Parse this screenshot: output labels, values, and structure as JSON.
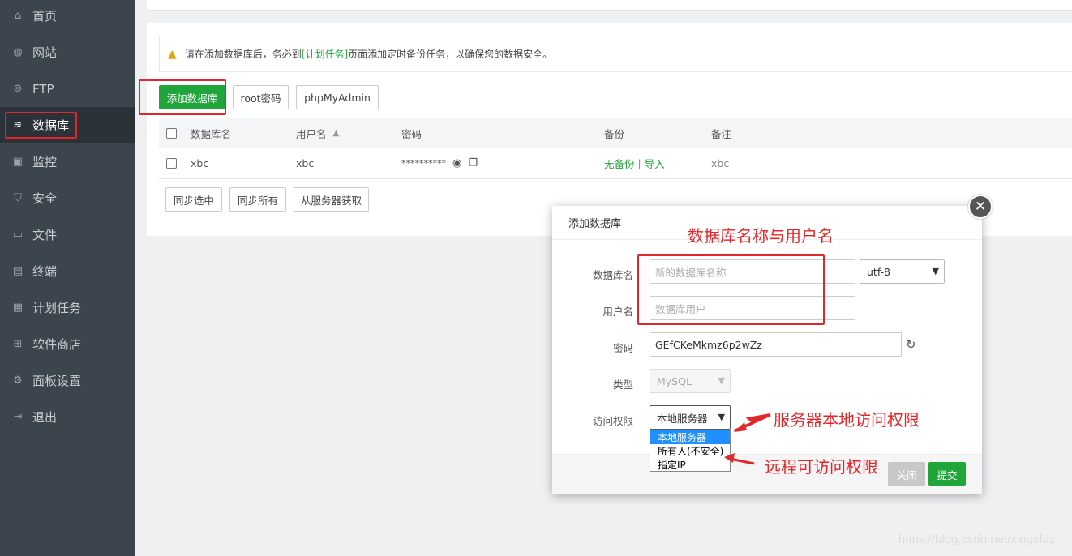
{
  "sidebar": {
    "items": [
      {
        "label": "首页",
        "icon": "home-icon",
        "glyph": "⌂"
      },
      {
        "label": "网站",
        "icon": "globe-icon",
        "glyph": "◍"
      },
      {
        "label": "FTP",
        "icon": "ftp-icon",
        "glyph": "⊜"
      },
      {
        "label": "数据库",
        "icon": "database-icon",
        "glyph": "≋"
      },
      {
        "label": "监控",
        "icon": "monitor-icon",
        "glyph": "▣"
      },
      {
        "label": "安全",
        "icon": "shield-icon",
        "glyph": "⛉"
      },
      {
        "label": "文件",
        "icon": "folder-icon",
        "glyph": "▭"
      },
      {
        "label": "终端",
        "icon": "terminal-icon",
        "glyph": "▤"
      },
      {
        "label": "计划任务",
        "icon": "calendar-icon",
        "glyph": "▦"
      },
      {
        "label": "软件商店",
        "icon": "apps-icon",
        "glyph": "⊞"
      },
      {
        "label": "面板设置",
        "icon": "gear-icon",
        "glyph": "⚙"
      },
      {
        "label": "退出",
        "icon": "logout-icon",
        "glyph": "⇥"
      }
    ]
  },
  "warning": {
    "before": "请在添加数据库后，务必到",
    "link": "[计划任务]",
    "after": "页面添加定时备份任务，以确保您的数据安全。"
  },
  "toolbar": {
    "add_db": "添加数据库",
    "root_pwd": "root密码",
    "phpmyadmin": "phpMyAdmin"
  },
  "table": {
    "headers": {
      "name": "数据库名",
      "user": "用户名",
      "password": "密码",
      "backup": "备份",
      "note": "备注"
    },
    "rows": [
      {
        "name": "xbc",
        "user": "xbc",
        "password": "**********",
        "backup_status": "无备份",
        "sep": "|",
        "import": "导入",
        "note": "xbc"
      }
    ]
  },
  "bottom_buttons": {
    "sync_selected": "同步选中",
    "sync_all": "同步所有",
    "fetch_server": "从服务器获取"
  },
  "dialog": {
    "title": "添加数据库",
    "fields": {
      "db_name_label": "数据库名",
      "db_name_placeholder": "新的数据库名称",
      "charset": "utf-8",
      "user_label": "用户名",
      "user_placeholder": "数据库用户",
      "password_label": "密码",
      "password_value": "GEfCKeMkmz6p2wZz",
      "type_label": "类型",
      "type_value": "MySQL",
      "access_label": "访问权限",
      "access_value": "本地服务器"
    },
    "access_options": [
      "本地服务器",
      "所有人(不安全)",
      "指定IP"
    ],
    "close_btn": "关闭",
    "submit_btn": "提交"
  },
  "annotations": {
    "name_user": "数据库名称与用户名",
    "local_access": "服务器本地访问权限",
    "remote_access": "远程可访问权限",
    "accent": "#e3262a"
  },
  "watermark": "https://blog.csdn.net/xingsfdz"
}
